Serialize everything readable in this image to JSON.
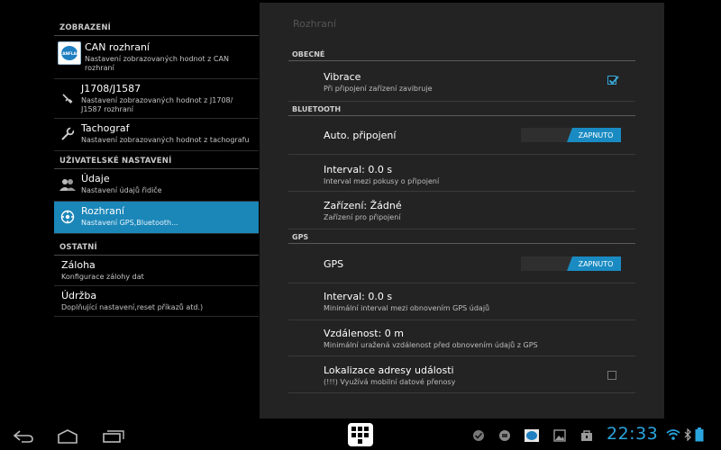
{
  "left": {
    "cat_display": "ZOBRAZENÍ",
    "cat_user": "UŽIVATELSKÉ NASTAVENÍ",
    "cat_other": "OSTATNÍ",
    "items": [
      {
        "title": "CAN rozhraní",
        "sub": "Nastavení zobrazovaných hodnot z CAN rozhraní",
        "icon": "canflap-logo"
      },
      {
        "title": "J1708/J1587",
        "sub": "Nastavení zobrazovaných hodnot z J1708/ J1587 rozhraní",
        "icon": "plug-icon"
      },
      {
        "title": "Tachograf",
        "sub": "Nastavení zobrazovaných hodnot z tachografu",
        "icon": "wrench-icon"
      },
      {
        "title": "Údaje",
        "sub": "Nastavení údajů řidiče",
        "icon": "users-icon"
      },
      {
        "title": "Rozhraní",
        "sub": "Nastavení GPS,Bluetooth...",
        "icon": "gear-icon"
      },
      {
        "title": "Záloha",
        "sub": "Konfigurace zálohy dat"
      },
      {
        "title": "Údržba",
        "sub": "Doplňující nastavení,reset příkazů atd.)"
      }
    ],
    "logo_text": "CANFLAP"
  },
  "panel": {
    "title": "Rozhraní",
    "sect_general": "OBECNÉ",
    "sect_bt": "BLUETOOTH",
    "sect_gps": "GPS",
    "vibrace": {
      "title": "Vibrace",
      "sub": "Při připojení zařízení zavibruje",
      "checked": true
    },
    "bt_auto": {
      "title": "Auto. připojení",
      "toggle": "ZAPNUTO"
    },
    "bt_interval": {
      "title": "Interval: 0.0 s",
      "sub": "Interval mezi pokusy o připojení"
    },
    "bt_device": {
      "title": "Zařízení: Žádné",
      "sub": "Zařízení pro připojení"
    },
    "gps": {
      "title": "GPS",
      "toggle": "ZAPNUTO"
    },
    "gps_interval": {
      "title": "Interval: 0.0 s",
      "sub": "Minimální interval mezi obnovením GPS údajů"
    },
    "gps_distance": {
      "title": "Vzdálenost: 0 m",
      "sub": "Minimální uražená vzdálenost před obnovením údajů z GPS"
    },
    "localization": {
      "title": "Lokalizace adresy události",
      "sub": "(!!!) Využívá mobilní datové přenosy",
      "checked": false
    }
  },
  "statusbar": {
    "clock": "22:33",
    "accent": "#2aa4dc",
    "notification_icons": [
      "check-icon",
      "app-icon",
      "canflap-icon",
      "image-icon",
      "bag-icon"
    ],
    "status_icons": [
      "wifi-icon",
      "bluetooth-icon",
      "battery-icon"
    ]
  }
}
